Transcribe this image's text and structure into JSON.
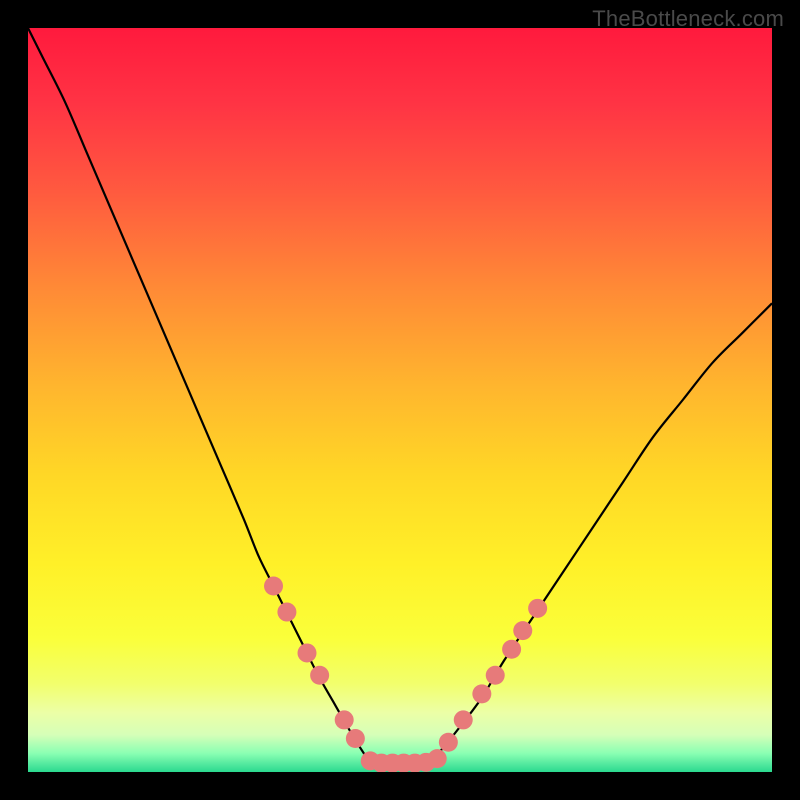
{
  "watermark": "TheBottleneck.com",
  "chart_data": {
    "type": "line",
    "title": "",
    "xlabel": "",
    "ylabel": "",
    "xlim": [
      0,
      100
    ],
    "ylim": [
      0,
      100
    ],
    "series": [
      {
        "name": "left-curve",
        "x": [
          0,
          2,
          5,
          8,
          11,
          14,
          17,
          20,
          23,
          26,
          29,
          31,
          33,
          35,
          37,
          39,
          41,
          43,
          44.5,
          46
        ],
        "y": [
          100,
          96,
          90,
          83,
          76,
          69,
          62,
          55,
          48,
          41,
          34,
          29,
          25,
          21,
          17,
          13,
          9.5,
          6,
          3.5,
          1.2
        ]
      },
      {
        "name": "right-curve",
        "x": [
          54,
          56,
          58,
          61,
          64,
          68,
          72,
          76,
          80,
          84,
          88,
          92,
          96,
          100
        ],
        "y": [
          1.2,
          3.5,
          6,
          10,
          15,
          21,
          27,
          33,
          39,
          45,
          50,
          55,
          59,
          63
        ]
      },
      {
        "name": "floor",
        "x": [
          46,
          54
        ],
        "y": [
          1.2,
          1.2
        ]
      }
    ],
    "markers_left": [
      {
        "x": 33.0,
        "y": 25.0
      },
      {
        "x": 34.8,
        "y": 21.5
      },
      {
        "x": 37.5,
        "y": 16.0
      },
      {
        "x": 39.2,
        "y": 13.0
      },
      {
        "x": 42.5,
        "y": 7.0
      },
      {
        "x": 44.0,
        "y": 4.5
      }
    ],
    "markers_right": [
      {
        "x": 56.5,
        "y": 4.0
      },
      {
        "x": 58.5,
        "y": 7.0
      },
      {
        "x": 61.0,
        "y": 10.5
      },
      {
        "x": 62.8,
        "y": 13.0
      },
      {
        "x": 65.0,
        "y": 16.5
      },
      {
        "x": 66.5,
        "y": 19.0
      },
      {
        "x": 68.5,
        "y": 22.0
      }
    ],
    "markers_bottom": [
      {
        "x": 46.0,
        "y": 1.5
      },
      {
        "x": 47.5,
        "y": 1.2
      },
      {
        "x": 49.0,
        "y": 1.2
      },
      {
        "x": 50.5,
        "y": 1.2
      },
      {
        "x": 52.0,
        "y": 1.2
      },
      {
        "x": 53.5,
        "y": 1.3
      },
      {
        "x": 55.0,
        "y": 1.8
      }
    ],
    "gradient_stops": [
      {
        "offset": 0.0,
        "color": "#ff1a3d"
      },
      {
        "offset": 0.1,
        "color": "#ff3344"
      },
      {
        "offset": 0.22,
        "color": "#ff5a3f"
      },
      {
        "offset": 0.35,
        "color": "#ff8a36"
      },
      {
        "offset": 0.48,
        "color": "#ffb52e"
      },
      {
        "offset": 0.6,
        "color": "#ffd726"
      },
      {
        "offset": 0.72,
        "color": "#fff028"
      },
      {
        "offset": 0.82,
        "color": "#faff3a"
      },
      {
        "offset": 0.88,
        "color": "#f2ff6b"
      },
      {
        "offset": 0.92,
        "color": "#ecffa6"
      },
      {
        "offset": 0.95,
        "color": "#d6ffb8"
      },
      {
        "offset": 0.975,
        "color": "#8affb3"
      },
      {
        "offset": 1.0,
        "color": "#2bd98f"
      }
    ],
    "marker_color": "#e77a7a",
    "line_color": "#000000"
  }
}
